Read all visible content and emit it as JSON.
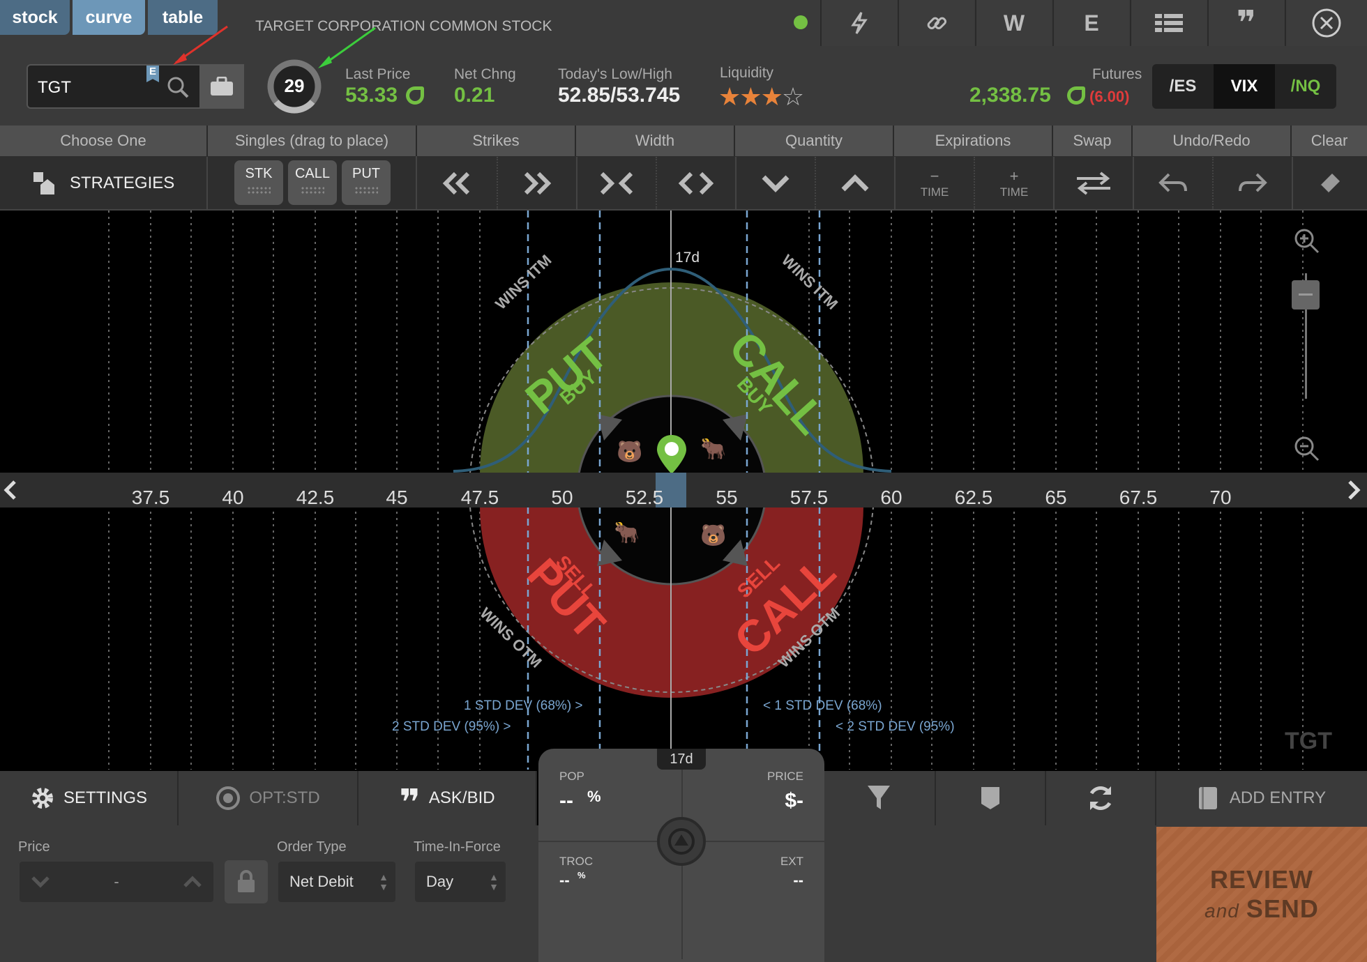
{
  "tabs": [
    {
      "label": "stock",
      "active": false
    },
    {
      "label": "curve",
      "active": true
    },
    {
      "label": "table",
      "active": false
    }
  ],
  "company_name": "TARGET CORPORATION COMMON STOCK",
  "toolbar_icons": [
    "lightning-icon",
    "link-icon",
    "W",
    "E",
    "list-icon",
    "quote-icon",
    "close-icon"
  ],
  "symbol": {
    "value": "TGT",
    "earnings_badge": "E"
  },
  "iv_rank": "29",
  "quote": {
    "last_price_label": "Last Price",
    "last_price": "53.33",
    "net_chng_label": "Net Chng",
    "net_chng": "0.21",
    "lowhigh_label": "Today's Low/High",
    "lowhigh": "52.85/53.745",
    "liquidity_label": "Liquidity",
    "liquidity_stars": 3,
    "liquidity_max": 4,
    "futures_label": "Futures",
    "futures_value": "2,338.75",
    "futures_change": "(6.00)"
  },
  "futures_buttons": [
    {
      "label": "/ES",
      "color": "#ffffff"
    },
    {
      "label": "VIX",
      "color": "#ffffff"
    },
    {
      "label": "/NQ",
      "color": "#74c043"
    }
  ],
  "toolbar": {
    "headers": [
      "Choose One",
      "Singles (drag to place)",
      "Strikes",
      "Width",
      "Quantity",
      "Expirations",
      "Swap",
      "Undo/Redo",
      "Clear"
    ],
    "strategies_label": "STRATEGIES",
    "singles": [
      "STK",
      "CALL",
      "PUT"
    ],
    "time_minus": "TIME",
    "time_plus": "TIME"
  },
  "curve": {
    "days_label": "17d",
    "axis_ticks": [
      "37.5",
      "40",
      "42.5",
      "45",
      "47.5",
      "50",
      "52.5",
      "55",
      "57.5",
      "60",
      "62.5",
      "65",
      "67.5",
      "70"
    ],
    "put_buy": "PUT",
    "buy_left": "BUY",
    "call_buy": "CALL",
    "buy_right": "BUY",
    "put_sell": "PUT",
    "sell_left": "SELL",
    "call_sell": "CALL",
    "sell_right": "SELL",
    "wins_itm": "WINS ITM",
    "wins_otm": "WINS OTM",
    "std1_left": "1 STD DEV (68%) >",
    "std2_left": "2 STD DEV (95%) >",
    "std1_right": "< 1 STD DEV (68%)",
    "std2_right": "< 2 STD DEV (95%)",
    "watermark": "TGT"
  },
  "colors": {
    "buy_green": "#4b5a26",
    "sell_red": "#872121",
    "accent_green": "#74c043",
    "std_blue": "#7aa6d1",
    "review_orange": "#b06a43"
  },
  "bottom_bar": {
    "settings": "SETTINGS",
    "opt": "OPT:STD",
    "askbid": "ASK/BID",
    "add_entry": "ADD ENTRY"
  },
  "trade_card": {
    "days": "17d",
    "pop_label": "POP",
    "pop_value": "--",
    "price_label": "PRICE",
    "price_value": "$-",
    "troc_label": "TROC",
    "troc_value": "--",
    "ext_label": "EXT",
    "ext_value": "--"
  },
  "order": {
    "price_label": "Price",
    "price_value": "-",
    "order_type_label": "Order Type",
    "order_type_value": "Net Debit",
    "tif_label": "Time-In-Force",
    "tif_value": "Day"
  },
  "review": {
    "line1": "REVIEW",
    "and": "and",
    "send": "SEND"
  }
}
